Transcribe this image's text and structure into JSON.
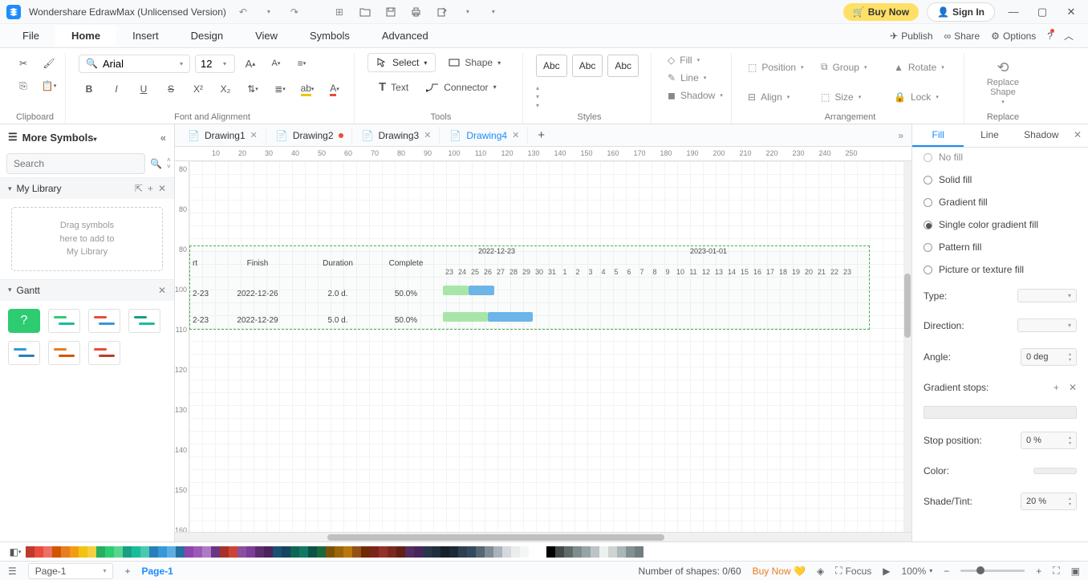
{
  "title": "Wondershare EdrawMax (Unlicensed Version)",
  "titlebar": {
    "buy_now": "Buy Now",
    "sign_in": "Sign In"
  },
  "menu": {
    "file": "File",
    "home": "Home",
    "insert": "Insert",
    "design": "Design",
    "view": "View",
    "symbols": "Symbols",
    "advanced": "Advanced",
    "publish": "Publish",
    "share": "Share",
    "options": "Options"
  },
  "ribbon": {
    "clipboard": "Clipboard",
    "font_align": "Font and Alignment",
    "font_name": "Arial",
    "font_size": "12",
    "tools": "Tools",
    "select": "Select",
    "shape": "Shape",
    "text": "Text",
    "connector": "Connector",
    "styles": "Styles",
    "abc": "Abc",
    "arrangement": "Arrangement",
    "fill": "Fill",
    "line": "Line",
    "shadow": "Shadow",
    "position": "Position",
    "align": "Align",
    "group": "Group",
    "size": "Size",
    "rotate": "Rotate",
    "lock": "Lock",
    "replace": "Replace",
    "replace_shape": "Replace\nShape"
  },
  "left": {
    "more_symbols": "More Symbols",
    "search_ph": "Search",
    "my_library": "My Library",
    "drop_hint": "Drag symbols\nhere to add to\nMy Library",
    "gantt": "Gantt"
  },
  "tabs": [
    {
      "label": "Drawing1",
      "active": false,
      "dirty": false
    },
    {
      "label": "Drawing2",
      "active": false,
      "dirty": true
    },
    {
      "label": "Drawing3",
      "active": false,
      "dirty": false
    },
    {
      "label": "Drawing4",
      "active": true,
      "dirty": false
    }
  ],
  "gantt": {
    "cols": [
      "rt",
      "Finish",
      "Duration",
      "Complete"
    ],
    "group1": "2022-12-23",
    "group2": "2023-01-01",
    "days": [
      "23",
      "24",
      "25",
      "26",
      "27",
      "28",
      "29",
      "30",
      "31",
      "1",
      "2",
      "3",
      "4",
      "5",
      "6",
      "7",
      "8",
      "9",
      "10",
      "11",
      "12",
      "13",
      "14",
      "15",
      "16",
      "17",
      "18",
      "19",
      "20",
      "21",
      "22",
      "23"
    ],
    "rows": [
      {
        "start": "2-23",
        "finish": "2022-12-26",
        "duration": "2.0 d.",
        "complete": "50.0%"
      },
      {
        "start": "2-23",
        "finish": "2022-12-29",
        "duration": "5.0 d.",
        "complete": "50.0%"
      }
    ]
  },
  "ruler_h": [
    "10",
    "20",
    "30",
    "40",
    "50",
    "60",
    "70",
    "80",
    "90",
    "100",
    "110",
    "120",
    "130",
    "140",
    "150",
    "160",
    "170",
    "180",
    "190",
    "200",
    "210",
    "220",
    "230",
    "240",
    "250"
  ],
  "ruler_v": [
    "80",
    "80",
    "80",
    "100",
    "110",
    "120",
    "130",
    "140",
    "150",
    "160"
  ],
  "right": {
    "tabs": {
      "fill": "Fill",
      "line": "Line",
      "shadow": "Shadow"
    },
    "no_fill": "No fill",
    "solid_fill": "Solid fill",
    "gradient_fill": "Gradient fill",
    "single_grad": "Single color gradient fill",
    "pattern_fill": "Pattern fill",
    "picture_fill": "Picture or texture fill",
    "type": "Type:",
    "direction": "Direction:",
    "angle": "Angle:",
    "angle_val": "0 deg",
    "grad_stops": "Gradient stops:",
    "stop_pos": "Stop position:",
    "stop_pos_val": "0 %",
    "color": "Color:",
    "shade": "Shade/Tint:",
    "shade_val": "20 %"
  },
  "status": {
    "page_sel": "Page-1",
    "page_active": "Page-1",
    "shapes": "Number of shapes: 0/60",
    "buy_now": "Buy Now",
    "focus": "Focus",
    "zoom": "100%"
  }
}
